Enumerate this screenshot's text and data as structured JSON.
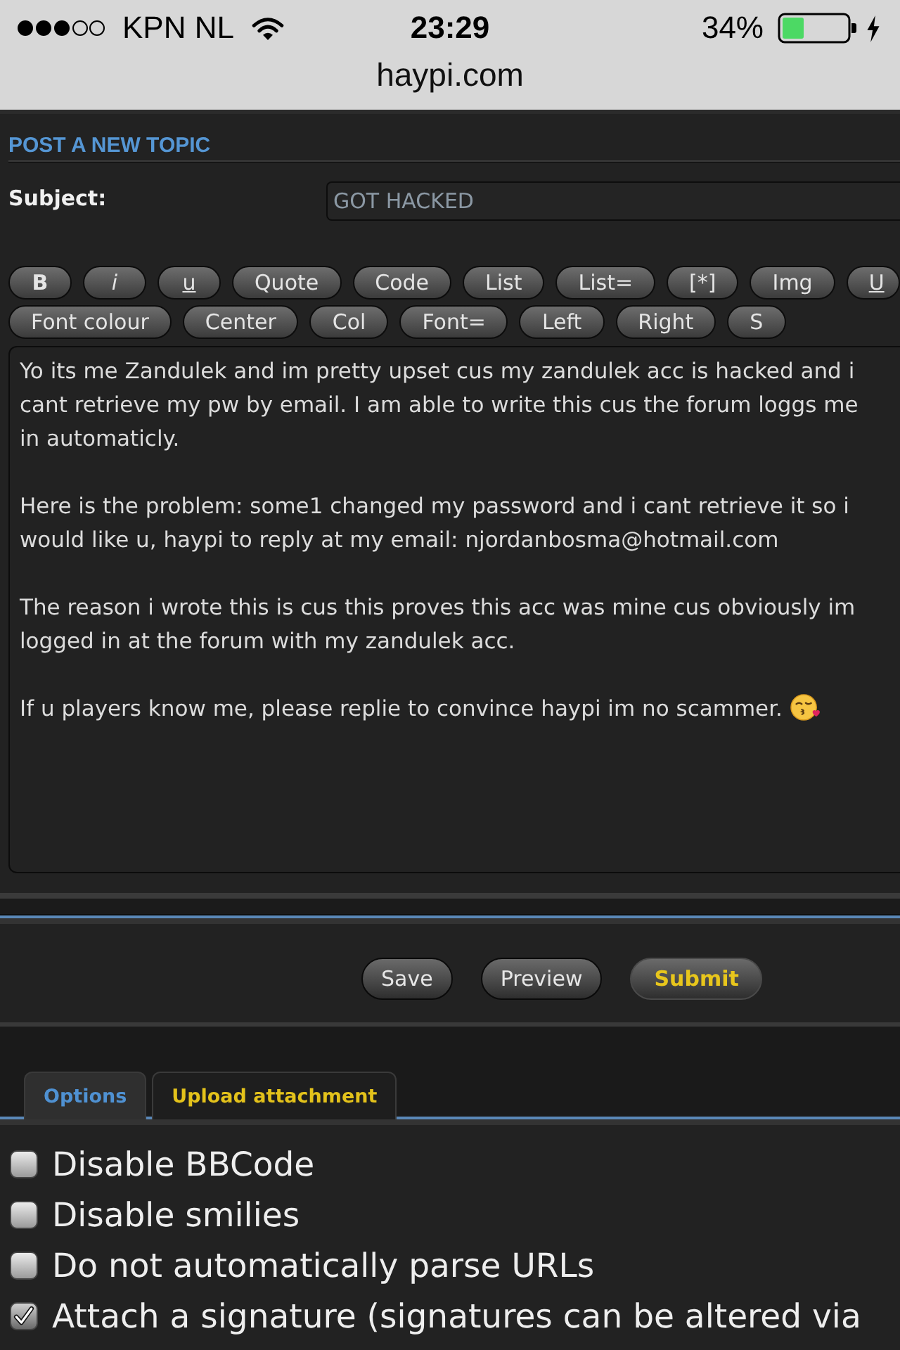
{
  "status_bar": {
    "carrier": "KPN NL",
    "time": "23:29",
    "battery": "34%"
  },
  "address_bar": {
    "url": "haypi.com"
  },
  "heading": "POST A NEW TOPIC",
  "subject": {
    "label": "Subject:",
    "value": "GOT HACKED"
  },
  "toolbar": {
    "rows": [
      {
        "buttons": [
          {
            "label": "B",
            "kind": "bold"
          },
          {
            "label": "i",
            "kind": "italic"
          },
          {
            "label": "u",
            "kind": "underline"
          },
          {
            "label": "Quote",
            "kind": "plain"
          },
          {
            "label": "Code",
            "kind": "plain"
          },
          {
            "label": "List",
            "kind": "plain"
          },
          {
            "label": "List=",
            "kind": "plain"
          },
          {
            "label": "[*]",
            "kind": "plain"
          },
          {
            "label": "Img",
            "kind": "plain"
          },
          {
            "label": "U",
            "kind": "underline"
          }
        ]
      },
      {
        "buttons": [
          {
            "label": "Font colour",
            "kind": "plain"
          },
          {
            "label": "Center",
            "kind": "plain"
          },
          {
            "label": "Col",
            "kind": "plain"
          },
          {
            "label": "Font=",
            "kind": "plain"
          },
          {
            "label": "Left",
            "kind": "plain"
          },
          {
            "label": "Right",
            "kind": "plain"
          },
          {
            "label": "S",
            "kind": "plain"
          }
        ]
      }
    ]
  },
  "message": {
    "paragraphs": [
      "Yo its me Zandulek and im pretty upset cus my zandulek acc is hacked and i cant retrieve my pw by email. I am able to write this cus the forum loggs me in automaticly.",
      "Here is the problem: some1 changed my password and i cant retrieve it so i would like u, haypi to reply at my email: njordanbosma@hotmail.com",
      "The reason i wrote this is cus this proves this acc was mine cus obviously im logged in at the forum with my zandulek acc.",
      "If u players know me, please replie to convince haypi im no scammer."
    ]
  },
  "actions": [
    {
      "label": "Save",
      "primary": false
    },
    {
      "label": "Preview",
      "primary": false
    },
    {
      "label": "Submit",
      "primary": true
    }
  ],
  "tabs": [
    {
      "label": "Options",
      "selected": true
    },
    {
      "label": "Upload attachment",
      "selected": false
    }
  ],
  "options": [
    {
      "label": "Disable BBCode",
      "checked": false
    },
    {
      "label": "Disable smilies",
      "checked": false
    },
    {
      "label": "Do not automatically parse URLs",
      "checked": false
    },
    {
      "label": "Attach a signature (signatures can be altered via",
      "checked": true
    }
  ]
}
